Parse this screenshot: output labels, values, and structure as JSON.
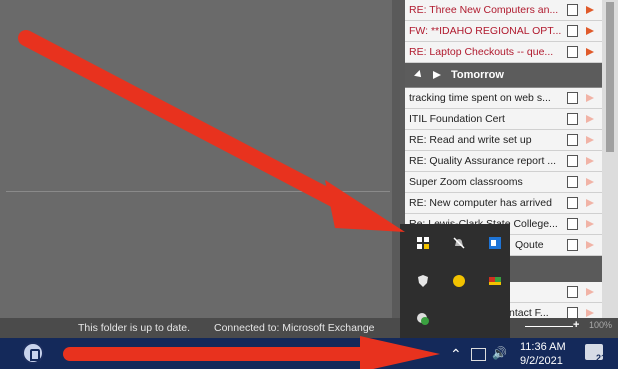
{
  "tasks_top": [
    {
      "subject": "RE: Three New Computers an...",
      "unread": true,
      "flag": "dark"
    },
    {
      "subject": "FW: **IDAHO REGIONAL OPT...",
      "unread": true,
      "flag": "dark"
    },
    {
      "subject": "RE: Laptop Checkouts -- que...",
      "unread": true,
      "flag": "dark"
    }
  ],
  "group_tomorrow": "Tomorrow",
  "tasks_tomorrow": [
    {
      "subject": "tracking time spent on web s...",
      "unread": false,
      "flag": "light"
    },
    {
      "subject": "ITIL Foundation Cert",
      "unread": false,
      "flag": "light"
    },
    {
      "subject": "RE: Read and write set up",
      "unread": false,
      "flag": "light"
    },
    {
      "subject": "RE: Quality Assurance report ...",
      "unread": false,
      "flag": "light"
    },
    {
      "subject": "Super Zoom classrooms",
      "unread": false,
      "flag": "light"
    },
    {
      "subject": "RE: New computer has arrived",
      "unread": false,
      "flag": "light"
    },
    {
      "subject": "Re: Lewis-Clark State College...",
      "unread": false,
      "flag": "light"
    },
    {
      "subject": "Qoute",
      "unread": false,
      "flag": "light"
    }
  ],
  "tasks_bottom": [
    {
      "subject": "",
      "unread": false,
      "flag": "light"
    },
    {
      "subject": "ntact F...",
      "unread": false,
      "flag": "light"
    }
  ],
  "status": {
    "folder": "This folder is up to date.",
    "connection": "Connected to: Microsoft Exchange",
    "zoom_pct": "100%"
  },
  "taskbar": {
    "time": "11:36 AM",
    "date": "9/2/2021",
    "notification_count": "21"
  },
  "tray_icons": [
    "windows-flag-icon",
    "muted-bell-icon",
    "outlook-icon",
    "shield-icon",
    "yellow-circle-icon",
    "colored-app-icon",
    "green-app-icon"
  ],
  "colors": {
    "arrow": "#e8321e",
    "taskbar": "#14295a",
    "unread": "#b01a2e",
    "flag": "#e05a2a"
  }
}
